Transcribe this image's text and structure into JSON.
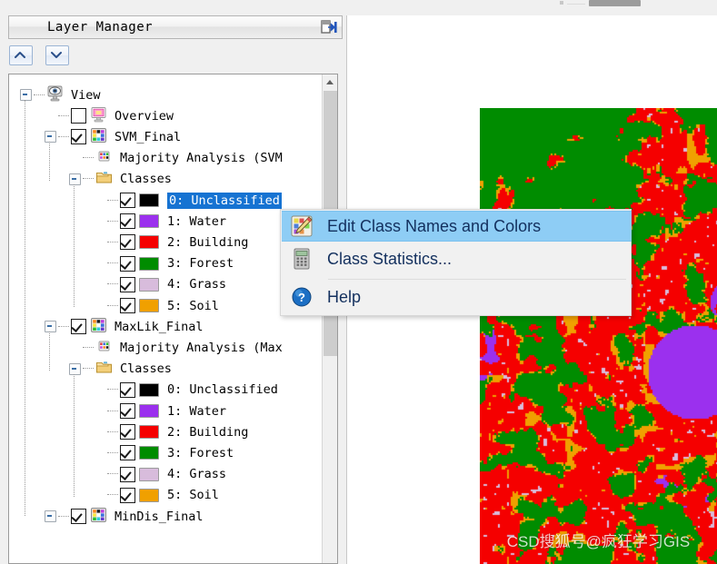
{
  "panel": {
    "title": "Layer Manager",
    "pin_icon": "dock-pin-icon",
    "toolbar": {
      "move_up_label": "move-up",
      "move_down_label": "move-down"
    }
  },
  "tree": [
    {
      "label": "View",
      "indent": 0,
      "expander": true,
      "checkbox": null,
      "icon": "view-eye-icon",
      "swatch": null
    },
    {
      "label": "Overview",
      "indent": 1,
      "expander": false,
      "checkbox": "off",
      "icon": "overview-monitor-icon",
      "swatch": null
    },
    {
      "label": "SVM_Final",
      "indent": 1,
      "expander": true,
      "checkbox": "on",
      "icon": "class-grid-icon",
      "swatch": null
    },
    {
      "label": "Majority Analysis (SVM",
      "indent": 2,
      "expander": false,
      "checkbox": null,
      "icon": "small-grid-icon",
      "swatch": null
    },
    {
      "label": "Classes",
      "indent": 2,
      "expander": true,
      "checkbox": null,
      "icon": "folder-icon",
      "swatch": null
    },
    {
      "label": "0: Unclassified",
      "indent": 3,
      "expander": false,
      "checkbox": "on",
      "icon": null,
      "swatch": "#000000",
      "selected": true
    },
    {
      "label": "1: Water",
      "indent": 3,
      "expander": false,
      "checkbox": "on",
      "icon": null,
      "swatch": "#9b30ee"
    },
    {
      "label": "2: Building",
      "indent": 3,
      "expander": false,
      "checkbox": "on",
      "icon": null,
      "swatch": "#f50000"
    },
    {
      "label": "3: Forest",
      "indent": 3,
      "expander": false,
      "checkbox": "on",
      "icon": null,
      "swatch": "#008c00"
    },
    {
      "label": "4: Grass",
      "indent": 3,
      "expander": false,
      "checkbox": "on",
      "icon": null,
      "swatch": "#d8bcdc"
    },
    {
      "label": "5: Soil",
      "indent": 3,
      "expander": false,
      "checkbox": "on",
      "icon": null,
      "swatch": "#f0a000"
    },
    {
      "label": "MaxLik_Final",
      "indent": 1,
      "expander": true,
      "checkbox": "on",
      "icon": "class-grid-icon",
      "swatch": null
    },
    {
      "label": "Majority Analysis (Max",
      "indent": 2,
      "expander": false,
      "checkbox": null,
      "icon": "small-grid-icon",
      "swatch": null
    },
    {
      "label": "Classes",
      "indent": 2,
      "expander": true,
      "checkbox": null,
      "icon": "folder-icon",
      "swatch": null
    },
    {
      "label": "0: Unclassified",
      "indent": 3,
      "expander": false,
      "checkbox": "on",
      "icon": null,
      "swatch": "#000000"
    },
    {
      "label": "1: Water",
      "indent": 3,
      "expander": false,
      "checkbox": "on",
      "icon": null,
      "swatch": "#9b30ee"
    },
    {
      "label": "2: Building",
      "indent": 3,
      "expander": false,
      "checkbox": "on",
      "icon": null,
      "swatch": "#f50000"
    },
    {
      "label": "3: Forest",
      "indent": 3,
      "expander": false,
      "checkbox": "on",
      "icon": null,
      "swatch": "#008c00"
    },
    {
      "label": "4: Grass",
      "indent": 3,
      "expander": false,
      "checkbox": "on",
      "icon": null,
      "swatch": "#d8bcdc"
    },
    {
      "label": "5: Soil",
      "indent": 3,
      "expander": false,
      "checkbox": "on",
      "icon": null,
      "swatch": "#f0a000"
    },
    {
      "label": "MinDis_Final",
      "indent": 1,
      "expander": true,
      "checkbox": "on",
      "icon": "class-grid-icon",
      "swatch": null
    }
  ],
  "context_menu": {
    "items": [
      {
        "label": "Edit Class Names and Colors",
        "icon": "palette-pencil-icon",
        "highlighted": true
      },
      {
        "label": "Class Statistics...",
        "icon": "calculator-icon",
        "highlighted": false
      },
      {
        "label": "Help",
        "icon": "help-question-icon",
        "highlighted": false
      }
    ]
  },
  "map": {
    "watermark": "CSD搜狐号@疯狂学习GIS",
    "class_colors": {
      "unclassified": "#000000",
      "water": "#9b30ee",
      "building": "#f50000",
      "forest": "#008c00",
      "grass": "#d8bcdc",
      "soil": "#f0a000"
    }
  },
  "theme": {
    "selection_blue": "#1673d2",
    "menu_highlight": "#8ecdf5",
    "panel_bg": "#f0f0f0"
  }
}
